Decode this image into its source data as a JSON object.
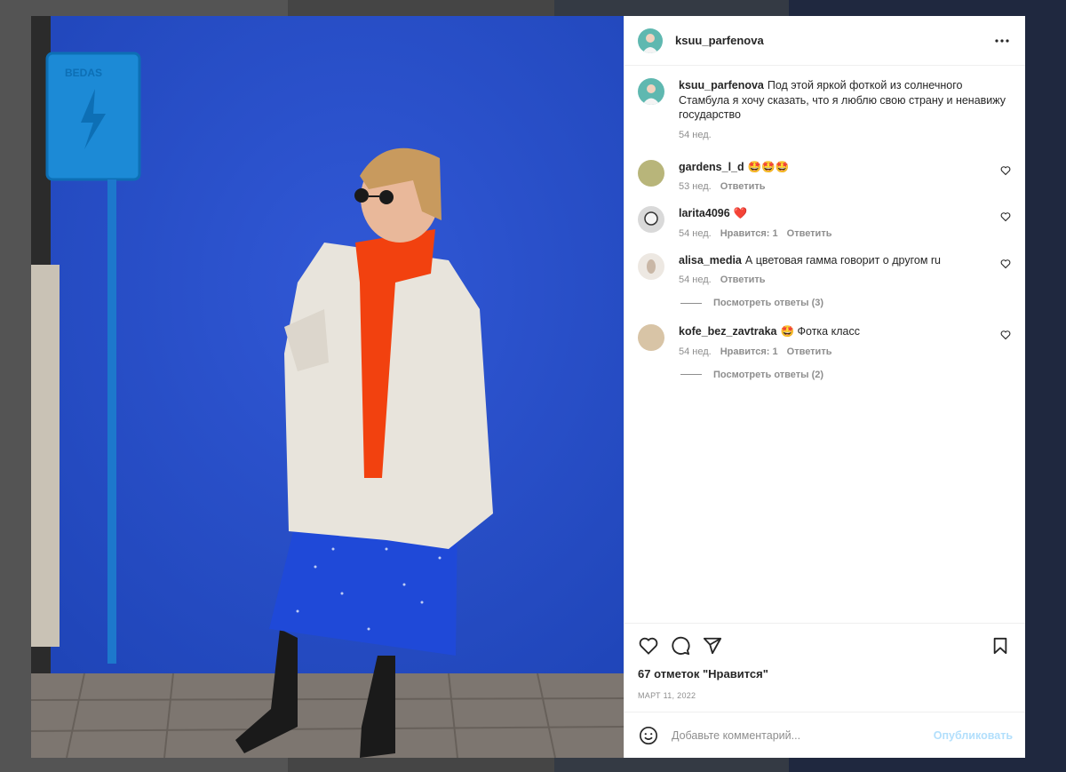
{
  "post": {
    "author": "ksuu_parfenova",
    "caption": "Под этой яркой фоткой из солнечного Стамбула я хочу сказать, что я люблю свою страну и ненавижу государство",
    "caption_time": "54 нед.",
    "likes": "67 отметок \"Нравится\"",
    "date": "МАРТ 11, 2022",
    "photo_sign": "BEDAS"
  },
  "comments": [
    {
      "author": "gardens_l_d",
      "text": "🤩🤩🤩",
      "time": "53 нед.",
      "likes": "",
      "reply": "Ответить"
    },
    {
      "author": "larita4096",
      "text": "❤️",
      "time": "54 нед.",
      "likes": "Нравится: 1",
      "reply": "Ответить"
    },
    {
      "author": "alisa_media",
      "text": "А цветовая гамма говорит о другом ru",
      "time": "54 нед.",
      "likes": "",
      "reply": "Ответить",
      "view_replies": "Посмотреть ответы (3)"
    },
    {
      "author": "kofe_bez_zavtraka",
      "text": "🤩 Фотка класс",
      "time": "54 нед.",
      "likes": "Нравится: 1",
      "reply": "Ответить",
      "view_replies": "Посмотреть ответы (2)"
    }
  ],
  "add_comment": {
    "placeholder": "Добавьте комментарий...",
    "publish": "Опубликовать"
  },
  "icons": {
    "more": "more-horizontal-icon",
    "like": "heart-icon",
    "comment": "comment-bubble-icon",
    "share": "paper-plane-icon",
    "save": "bookmark-icon",
    "emoji": "smiley-icon"
  },
  "colors": {
    "publish_disabled": "#b2dffc",
    "secondary_text": "#8e8e8e",
    "wall_blue": "#2a52c8"
  }
}
